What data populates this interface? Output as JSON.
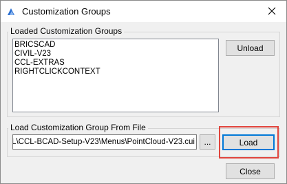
{
  "window": {
    "title": "Customization Groups",
    "app_icon": "bricscad-logo-icon",
    "close_icon": "close-icon"
  },
  "loaded_group": {
    "label": "Loaded Customization Groups",
    "items": [
      "BRICSCAD",
      "CIVIL-V23",
      "CCL-EXTRAS",
      "RIGHTCLICKCONTEXT"
    ],
    "unload_label": "Unload"
  },
  "load_group": {
    "label": "Load Customization Group From File",
    "path_value": "\\CCL\\CCL-BCAD-Setup-V23\\Menus\\PointCloud-V23.cui",
    "browse_label": "...",
    "load_label": "Load"
  },
  "footer": {
    "close_label": "Close"
  },
  "colors": {
    "highlight": "#e0443c",
    "focus_border": "#0078d7"
  }
}
